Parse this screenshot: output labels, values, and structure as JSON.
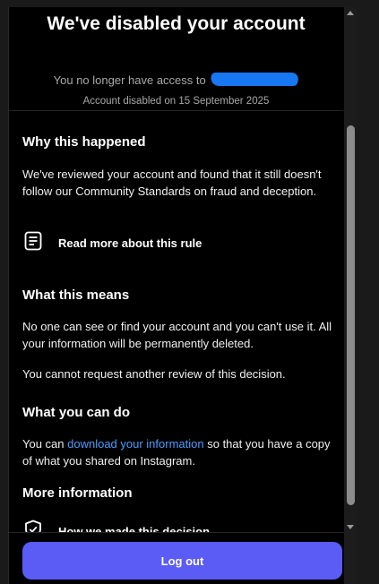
{
  "header": {
    "title": "We've disabled your account",
    "subtitle_prefix": "You no longer have access to",
    "disabled_date": "Account disabled on 15 September 2025"
  },
  "sections": {
    "why": {
      "heading": "Why this happened",
      "body": "We've reviewed your account and found that it still doesn't follow our Community Standards on fraud and deception.",
      "action_label": "Read more about this rule"
    },
    "means": {
      "heading": "What this means",
      "body1": "No one can see or find your account and you can't use it. All your information will be permanently deleted.",
      "body2": "You cannot request another review of this decision."
    },
    "can_do": {
      "heading": "What you can do",
      "prefix": "You can ",
      "link": "download your information",
      "suffix": " so that you have a copy of what you shared on Instagram."
    },
    "more": {
      "heading": "More information",
      "action_label": "How we made this decision"
    }
  },
  "footer": {
    "logout_label": "Log out"
  },
  "icons": {
    "rule": "document-icon",
    "decision": "shield-check-icon"
  },
  "colors": {
    "background": "#000000",
    "primary_button": "#5b5cf6",
    "link": "#4c9bff",
    "redaction": "#1877f2"
  }
}
